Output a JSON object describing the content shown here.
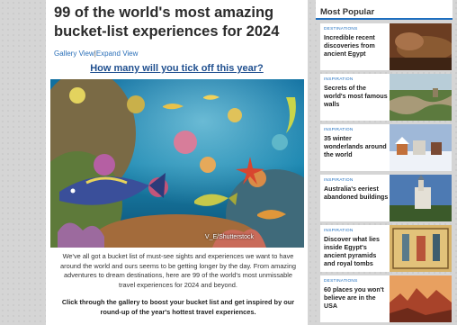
{
  "article": {
    "headline": "99 of the world's most amazing bucket-list experiences for 2024",
    "view_links": [
      "Gallery View",
      "Expand View"
    ],
    "view_separator": "|",
    "subhead": "How many will you tick off this year?",
    "image_credit": "V_E/Shutterstock",
    "intro": "We've all got a bucket list of must-see sights and experiences we want to have around the world and ours seems to be getting longer by the day. From amazing adventures to dream destinations, here are 99 of the world's most unmissable travel experiences for 2024 and beyond.",
    "cta": "Click through the gallery to boost your bucket list and get inspired by our round-up of the year's hottest travel experiences."
  },
  "sidebar": {
    "heading": "Most Popular",
    "items": [
      {
        "category": "DESTINATIONS",
        "title": "Incredible recent discoveries from ancient Egypt",
        "thumb": "egypt-tomb-thumbnail"
      },
      {
        "category": "INSPIRATION",
        "title": "Secrets of the world's most famous walls",
        "thumb": "great-wall-thumbnail"
      },
      {
        "category": "INSPIRATION",
        "title": "35 winter wonderlands around the world",
        "thumb": "winter-village-thumbnail"
      },
      {
        "category": "INSPIRATION",
        "title": "Australia's eeriest abandoned buildings",
        "thumb": "castle-thumbnail"
      },
      {
        "category": "INSPIRATION",
        "title": "Discover what lies inside Egypt's ancient pyramids and royal tombs",
        "thumb": "tomb-painting-thumbnail"
      },
      {
        "category": "DESTINATIONS",
        "title": "60 places you won't believe are in the USA",
        "thumb": "red-rock-thumbnail"
      }
    ]
  },
  "colors": {
    "link": "#2a6fb8",
    "subhead": "#1f4f8f",
    "accent_rule": "#1f6fbf",
    "page_background": "#d5d5d5"
  }
}
